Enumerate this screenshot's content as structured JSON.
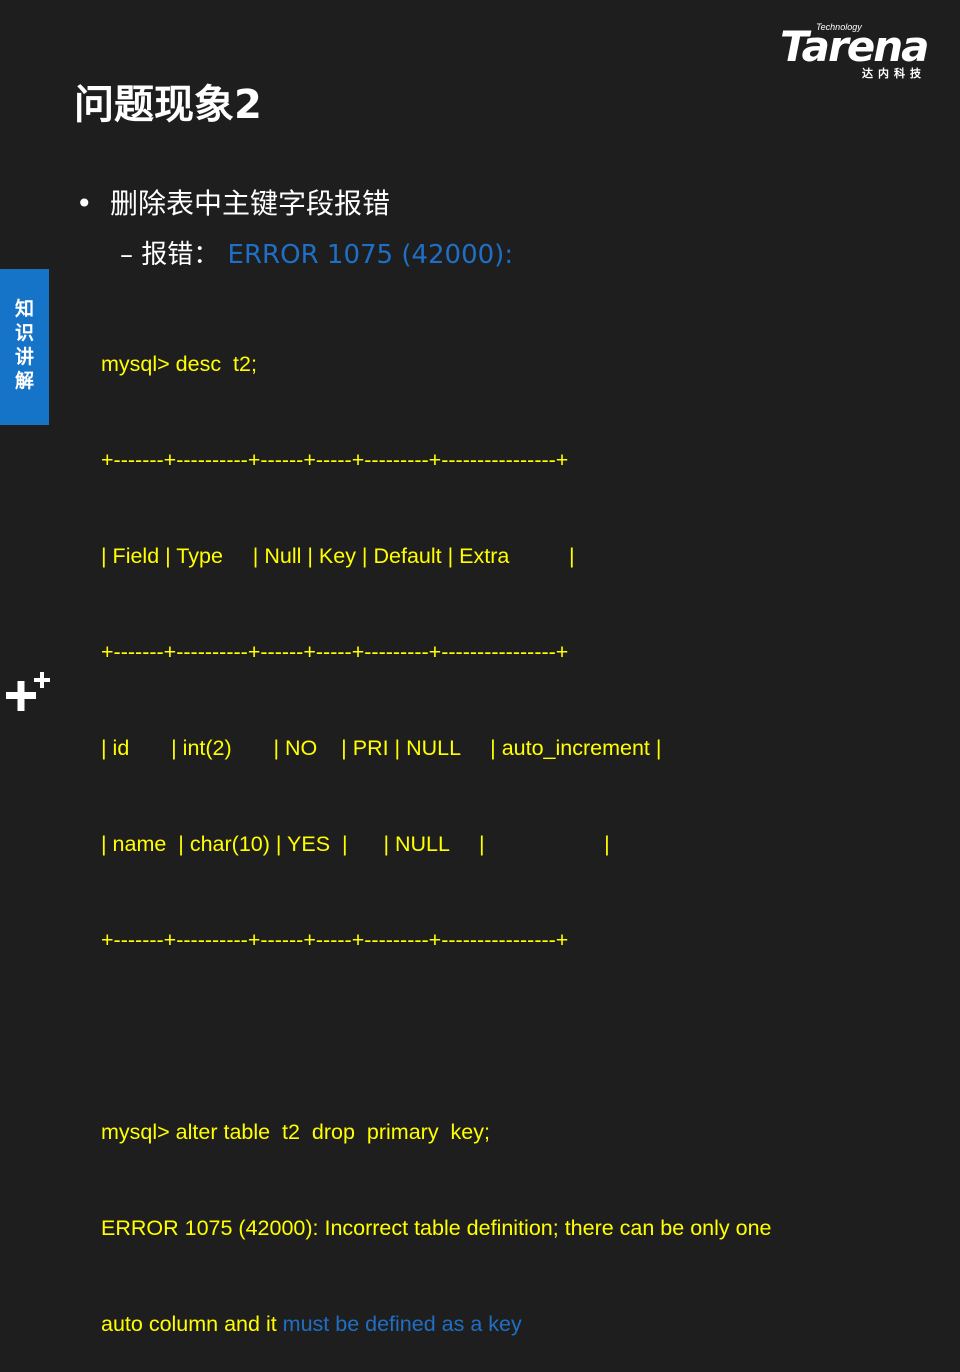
{
  "logo": {
    "tech": "Technology",
    "word": "Tarena",
    "cn": "达内科技"
  },
  "title": "问题现象2",
  "bullet": {
    "marker": "•",
    "text": "删除表中主键字段报错"
  },
  "sub": {
    "marker": "–",
    "label": "报错：",
    "error": "ERROR 1075 (42000):"
  },
  "side_tab": [
    "知",
    "识",
    "讲",
    "解"
  ],
  "code": {
    "cmd1": "mysql> desc  t2;",
    "sep1": "+-------+----------+------+-----+---------+----------------+",
    "header": "| Field | Type     | Null | Key | Default | Extra          |",
    "sep2": "+-------+----------+------+-----+---------+----------------+",
    "row1": "| id       | int(2)       | NO    | PRI | NULL     | auto_increment |",
    "row2": "| name  | char(10) | YES  |      | NULL     |                    |",
    "sep3": "+-------+----------+------+-----+---------+----------------+",
    "blank": "",
    "cmd2": "mysql> alter table  t2  drop  primary  key;",
    "err1": "ERROR 1075 (42000): Incorrect table definition; there can be only one",
    "err2_a": "auto column and it ",
    "err2_b": "must be defined as a key"
  },
  "colors": {
    "background": "#1f1e1e",
    "code_yellow": "#ffff00",
    "accent_blue": "#1e6fc5",
    "tab_blue": "#1674c8"
  }
}
